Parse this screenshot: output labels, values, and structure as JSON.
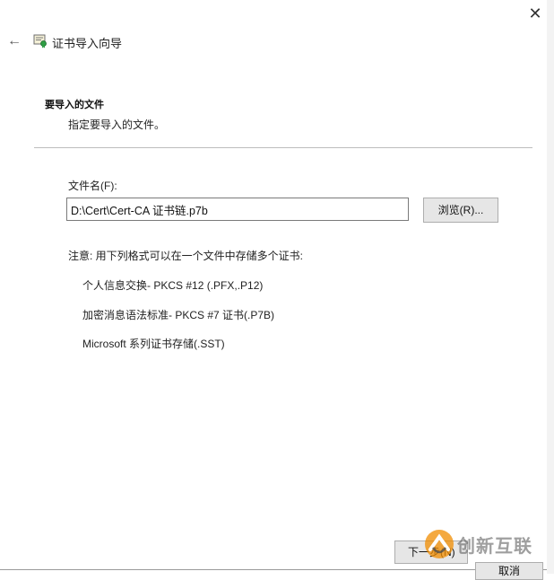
{
  "window": {
    "title": "证书导入向导",
    "close_symbol": "✕",
    "back_symbol": "←"
  },
  "header": {
    "section_title": "要导入的文件",
    "section_desc": "指定要导入的文件。"
  },
  "form": {
    "file_label": "文件名(F):",
    "file_value": "D:\\Cert\\Cert-CA 证书链.p7b",
    "browse_label": "浏览(R)..."
  },
  "note": {
    "text": "注意: 用下列格式可以在一个文件中存储多个证书:",
    "formats": [
      "个人信息交换- PKCS #12 (.PFX,.P12)",
      "加密消息语法标准- PKCS #7 证书(.P7B)",
      "Microsoft 系列证书存储(.SST)"
    ]
  },
  "footer": {
    "next_label": "下一步(N)",
    "cancel_label": "取消"
  },
  "watermark": {
    "text": "创新互联"
  },
  "icons": {
    "title_icon": "certificate-icon",
    "back_icon": "back-arrow-icon",
    "close_icon": "close-icon",
    "watermark_logo": "brand-logo-icon"
  }
}
